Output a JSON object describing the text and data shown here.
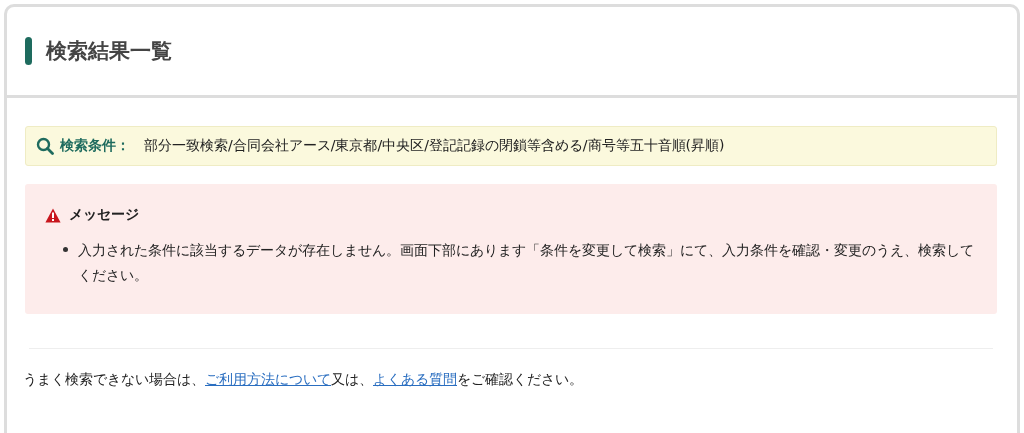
{
  "page_title": "検索結果一覧",
  "search_conditions": {
    "label": "検索条件：",
    "value": "部分一致検索/合同会社アース/東京都/中央区/登記記録の閉鎖等含める/商号等五十音順(昇順)"
  },
  "message": {
    "title": "メッセージ",
    "items": [
      "入力された条件に該当するデータが存在しません。画面下部にあります「条件を変更して検索」にて、入力条件を確認・変更のうえ、検索してください。"
    ]
  },
  "help_text": [
    {
      "kind": "text",
      "text": "うまく検索できない場合は、"
    },
    {
      "kind": "link",
      "text": "ご利用方法について"
    },
    {
      "kind": "text",
      "text": "又は、"
    },
    {
      "kind": "link",
      "text": "よくある質問"
    },
    {
      "kind": "text",
      "text": "をご確認ください。"
    }
  ]
}
